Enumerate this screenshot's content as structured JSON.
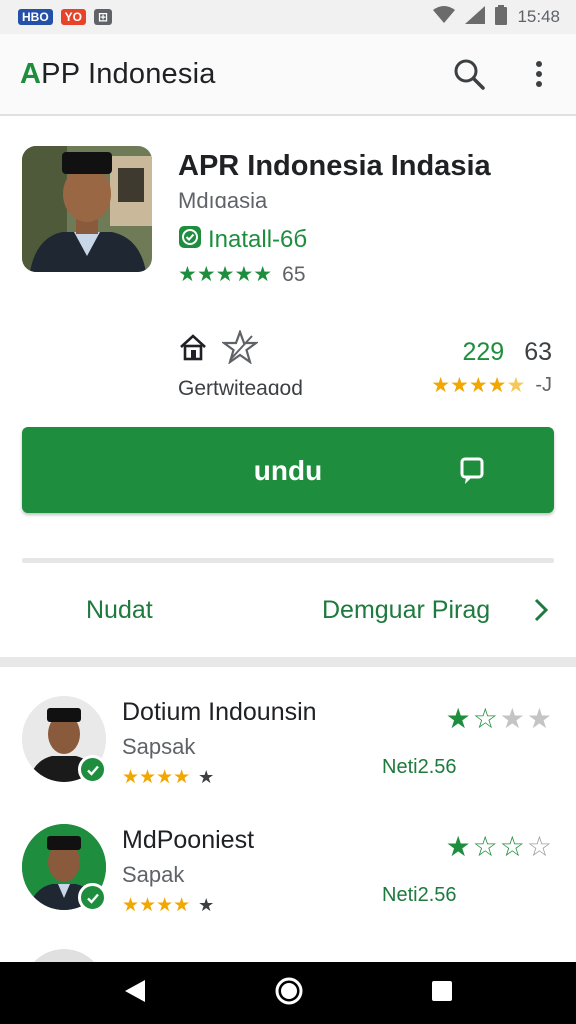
{
  "status_bar": {
    "badges": [
      {
        "label": "HBO",
        "color": "#2451a6"
      },
      {
        "label": "YO",
        "color": "#e5432a"
      },
      {
        "label": "⊞",
        "color": "#5f6368"
      }
    ],
    "time": "15:48"
  },
  "app_bar": {
    "title_prefix": "A",
    "title_rest": "PP Indonesia",
    "search_icon": "search-icon",
    "menu_icon": "more-vert-icon"
  },
  "app": {
    "name": "APR Indonesia Indasia",
    "subtitle": "Mdıɑasia",
    "install_label": "Inatall-6б",
    "stars": "★★★★★",
    "rating_count": "65"
  },
  "meta": {
    "label": "Gertwiteaɑod",
    "value_primary": "229",
    "value_secondary": "63",
    "stars": "★★★★",
    "half_star": "★",
    "rating_suffix": "-J"
  },
  "cta": {
    "label": "undu"
  },
  "tabs": {
    "left": "Nudat",
    "right": "Demguar Pirag"
  },
  "developers": [
    {
      "name": "Dotium Indounsin",
      "subtitle": "Sapsak",
      "stars": "★★★★",
      "rating_suffix": "★",
      "right_stars_green": "★☆",
      "right_stars_grey": "★★",
      "price": "Neti2.56",
      "avatar_bg": "#e9e9e9"
    },
    {
      "name": "MdPooniest",
      "subtitle": "Sapak",
      "stars": "★★★★",
      "rating_suffix": "★",
      "right_stars_green": "★☆☆",
      "right_stars_grey": "☆",
      "price": "Neti2.56",
      "avatar_bg": "#1e8e3e"
    }
  ],
  "colors": {
    "accent": "#1e8e3e",
    "gold": "#f2a600"
  }
}
